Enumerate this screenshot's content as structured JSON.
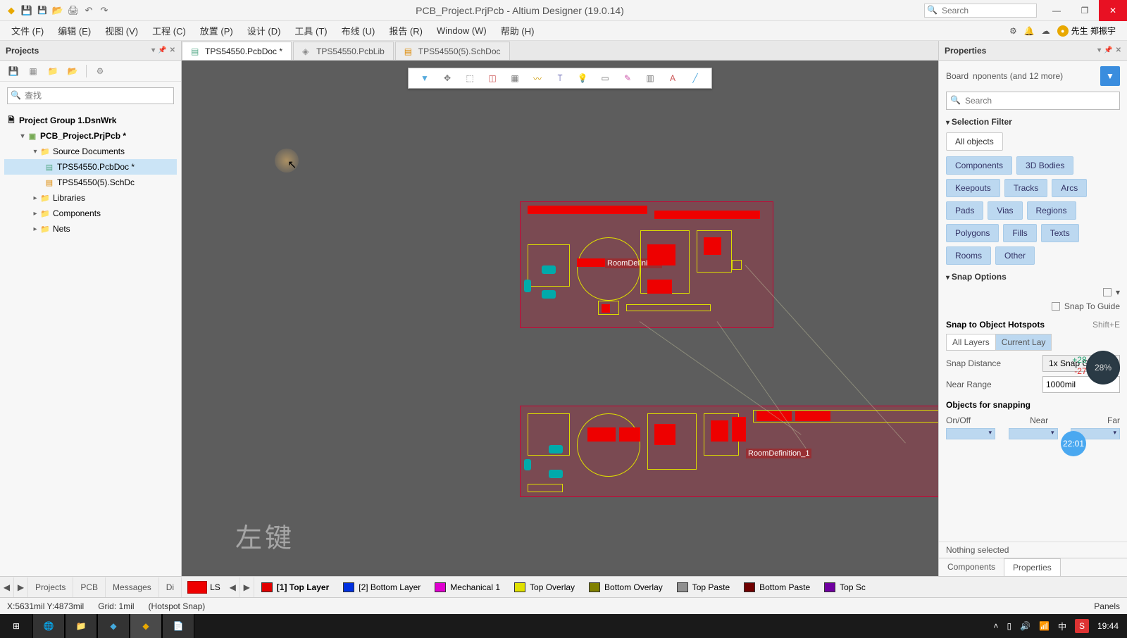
{
  "title": "PCB_Project.PrjPcb - Altium Designer (19.0.14)",
  "search_ph": "Search",
  "menu": [
    "文件 (F)",
    "编辑 (E)",
    "视图 (V)",
    "工程 (C)",
    "放置 (P)",
    "设计 (D)",
    "工具 (T)",
    "布线 (U)",
    "报告 (R)",
    "Window (W)",
    "帮助 (H)"
  ],
  "user": "先生 郑振宇",
  "projects": {
    "title": "Projects",
    "search_ph": "查找",
    "group": "Project Group 1.DsnWrk",
    "project": "PCB_Project.PrjPcb *",
    "srcdocs": "Source Documents",
    "doc1": "TPS54550.PcbDoc *",
    "doc2": "TPS54550(5).SchDc",
    "libs": "Libraries",
    "comps": "Components",
    "nets": "Nets"
  },
  "tabs": [
    {
      "label": "TPS54550.PcbDoc *",
      "active": true
    },
    {
      "label": "TPS54550.PcbLib",
      "active": false
    },
    {
      "label": "TPS54550(5).SchDoc",
      "active": false
    }
  ],
  "room1": "RoomDefinition",
  "room2": "RoomDefinition_1",
  "watermark": "左键",
  "props": {
    "title": "Properties",
    "board": "Board",
    "board_note": "nponents (and 12 more)",
    "search_ph": "Search",
    "sel_filter": "Selection Filter",
    "all_obj": "All objects",
    "pills": [
      "Components",
      "3D Bodies",
      "Keepouts",
      "Tracks",
      "Arcs",
      "Pads",
      "Vias",
      "Regions",
      "Polygons",
      "Fills",
      "Texts",
      "Rooms",
      "Other"
    ],
    "snap_opt": "Snap Options",
    "snap_guide": "Snap To Guide",
    "snap_hot": "Snap to Object Hotspots",
    "snap_shortcut": "Shift+E",
    "segs": [
      "All Layers",
      "Current Lay"
    ],
    "snap_dist": "Snap Distance",
    "snap_dist_val": "1x Snap Grid",
    "near_range": "Near Range",
    "near_range_val": "1000mil",
    "obj_snap": "Objects for snapping",
    "cols": [
      "On/Off",
      "Near",
      "Far"
    ],
    "nothing": "Nothing selected",
    "tabs": [
      "Components",
      "Properties"
    ]
  },
  "bottom_tabs": [
    "Projects",
    "PCB",
    "Messages",
    "Di"
  ],
  "ls_label": "LS",
  "layers": [
    {
      "label": "[1] Top Layer",
      "color": "#e00000",
      "active": true
    },
    {
      "label": "[2] Bottom Layer",
      "color": "#0030e0",
      "active": false
    },
    {
      "label": "Mechanical 1",
      "color": "#e000d0",
      "active": false
    },
    {
      "label": "Top Overlay",
      "color": "#e0e000",
      "active": false
    },
    {
      "label": "Bottom Overlay",
      "color": "#808000",
      "active": false
    },
    {
      "label": "Top Paste",
      "color": "#909090",
      "active": false
    },
    {
      "label": "Bottom Paste",
      "color": "#700000",
      "active": false
    },
    {
      "label": "Top Sc",
      "color": "#7000a0",
      "active": false
    }
  ],
  "status": {
    "coord": "X:5631mil Y:4873mil",
    "grid": "Grid: 1mil",
    "snap": "(Hotspot Snap)",
    "panels": "Panels"
  },
  "perf": {
    "up": "+28.1K/s",
    "down": "-27.3K/s",
    "pct": "28%"
  },
  "timer": "22:01",
  "clock": "19:44",
  "ime": "中"
}
